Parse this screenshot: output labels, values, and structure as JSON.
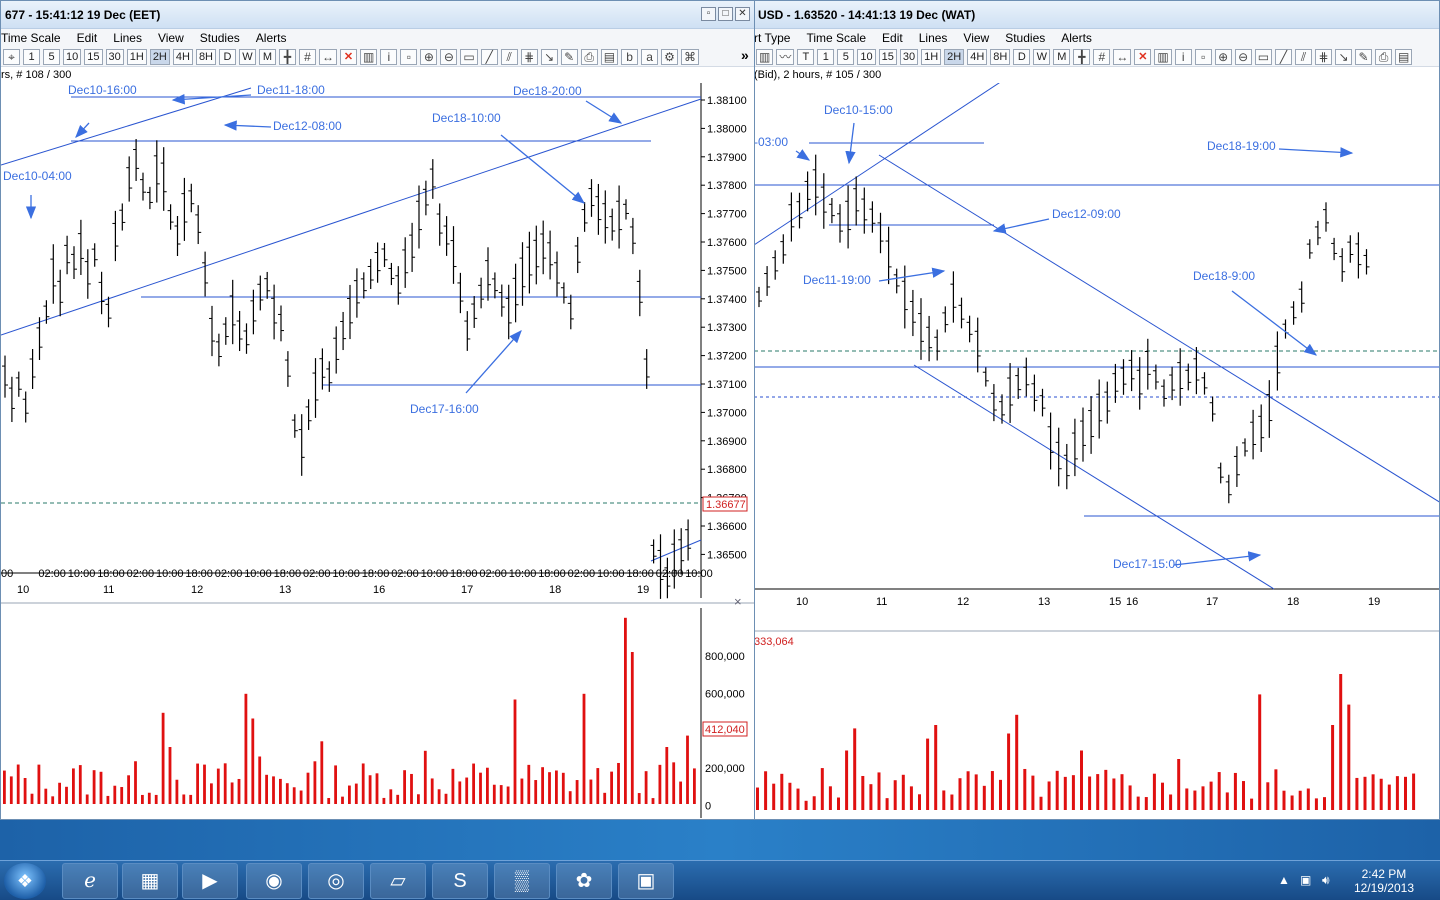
{
  "window1": {
    "title": "677 - 15:41:12  19 Dec (EET)",
    "menu": [
      "Time Scale",
      "Edit",
      "Lines",
      "View",
      "Studies",
      "Alerts"
    ],
    "toolbar_buttons": [
      "1",
      "5",
      "10",
      "15",
      "30",
      "1H",
      "2H",
      "4H",
      "8H",
      "D",
      "W",
      "M"
    ],
    "active_interval": "2H",
    "info": "rs, # 108 / 300",
    "price_box": "1.36677",
    "volume_box": "412,040",
    "scroll_arrow": "»",
    "close_x": "×",
    "price_labels": [
      "1.38100",
      "1.38000",
      "1.37900",
      "1.37800",
      "1.37700",
      "1.37600",
      "1.37500",
      "1.37400",
      "1.37300",
      "1.37200",
      "1.37100",
      "1.37000",
      "1.36900",
      "1.36800",
      "1.36700",
      "1.36600",
      "1.36500"
    ],
    "time_labels": [
      "00",
      "02:00",
      "10:00",
      "18:00",
      "02:00",
      "10:00",
      "18:00",
      "02:00",
      "10:00",
      "18:00",
      "02:00",
      "10:00",
      "18:00",
      "02:00",
      "10:00",
      "18:00",
      "02:00",
      "10:00",
      "18:00",
      "02:00",
      "10:00",
      "18:00",
      "02:00",
      "10:00"
    ],
    "day_labels": [
      "10",
      "11",
      "12",
      "13",
      "16",
      "17",
      "18",
      "19"
    ],
    "volume_labels": [
      "800,000",
      "600,000",
      "400,000",
      "200,000",
      "0"
    ],
    "annotations": [
      "Dec10-16:00",
      "Dec11-18:00",
      "Dec12-08:00",
      "Dec18-20:00",
      "Dec18-10:00",
      "Dec10-04:00",
      "Dec17-16:00"
    ]
  },
  "window2": {
    "title": "USD - 1.63520 - 14:41:13  19 Dec (WAT)",
    "menu": [
      "rt Type",
      "Time Scale",
      "Edit",
      "Lines",
      "View",
      "Studies",
      "Alerts"
    ],
    "toolbar_buttons": [
      "T",
      "1",
      "5",
      "10",
      "15",
      "30",
      "1H",
      "2H",
      "4H",
      "8H",
      "D",
      "W",
      "M"
    ],
    "active_interval": "2H",
    "info": "(Bid), 2 hours, # 105 / 300",
    "volume_top": "333,064",
    "day_labels": [
      "10",
      "11",
      "12",
      "13",
      "15",
      "16",
      "17",
      "18",
      "19"
    ],
    "annotations": [
      "Dec10-15:00",
      "-03:00",
      "Dec18-19:00",
      "Dec12-09:00",
      "Dec11-19:00",
      "Dec18-9:00",
      "Dec17-15:00"
    ]
  },
  "taskbar": {
    "time": "2:42 PM",
    "date": "12/19/2013",
    "apps": [
      "windows-explorer",
      "internet-explorer",
      "file-explorer",
      "media-player",
      "firefox",
      "chrome",
      "notes",
      "skype",
      "equalizer",
      "paint",
      "terminal"
    ]
  },
  "colors": {
    "annotation": "#3b6fe0",
    "volume": "#e01010",
    "line": "#2a55d0",
    "bar": "#000000"
  }
}
